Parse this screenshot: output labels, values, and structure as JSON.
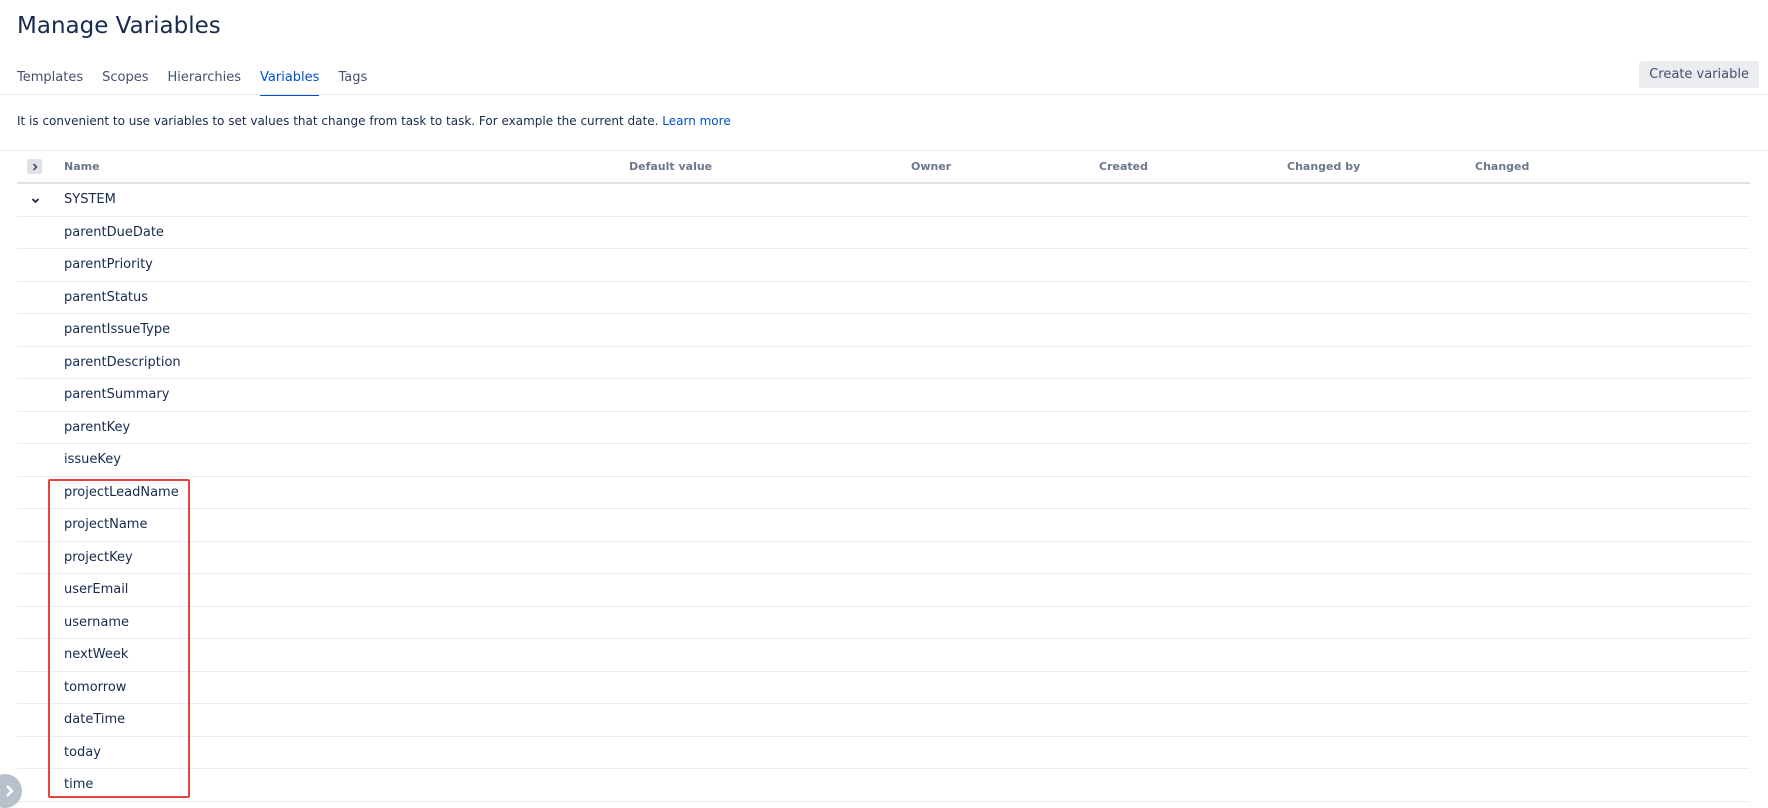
{
  "page": {
    "title": "Manage Variables"
  },
  "tabs": [
    {
      "label": "Templates",
      "active": false
    },
    {
      "label": "Scopes",
      "active": false
    },
    {
      "label": "Hierarchies",
      "active": false
    },
    {
      "label": "Variables",
      "active": true
    },
    {
      "label": "Tags",
      "active": false
    }
  ],
  "toolbar": {
    "create_label": "Create variable"
  },
  "intro": {
    "text": "It is convenient to use variables to set values that change from task to task. For example the current date.",
    "link": "Learn more"
  },
  "table": {
    "columns": [
      "Name",
      "Default value",
      "Owner",
      "Created",
      "Changed by",
      "Changed"
    ],
    "group": {
      "name": "SYSTEM",
      "expanded": true
    },
    "rows": [
      "parentDueDate",
      "parentPriority",
      "parentStatus",
      "parentIssueType",
      "parentDescription",
      "parentSummary",
      "parentKey",
      "issueKey",
      "projectLeadName",
      "projectName",
      "projectKey",
      "userEmail",
      "username",
      "nextWeek",
      "tomorrow",
      "dateTime",
      "today",
      "time"
    ]
  },
  "icons": {
    "expand_all": "chevron-right-icon",
    "group_toggle": "chevron-down-icon",
    "sidebar_toggle": "chevron-right-icon"
  },
  "colors": {
    "accent": "#0052cc",
    "text": "#172b4d",
    "header_text": "#6b778c",
    "highlight": "#e2463f"
  }
}
